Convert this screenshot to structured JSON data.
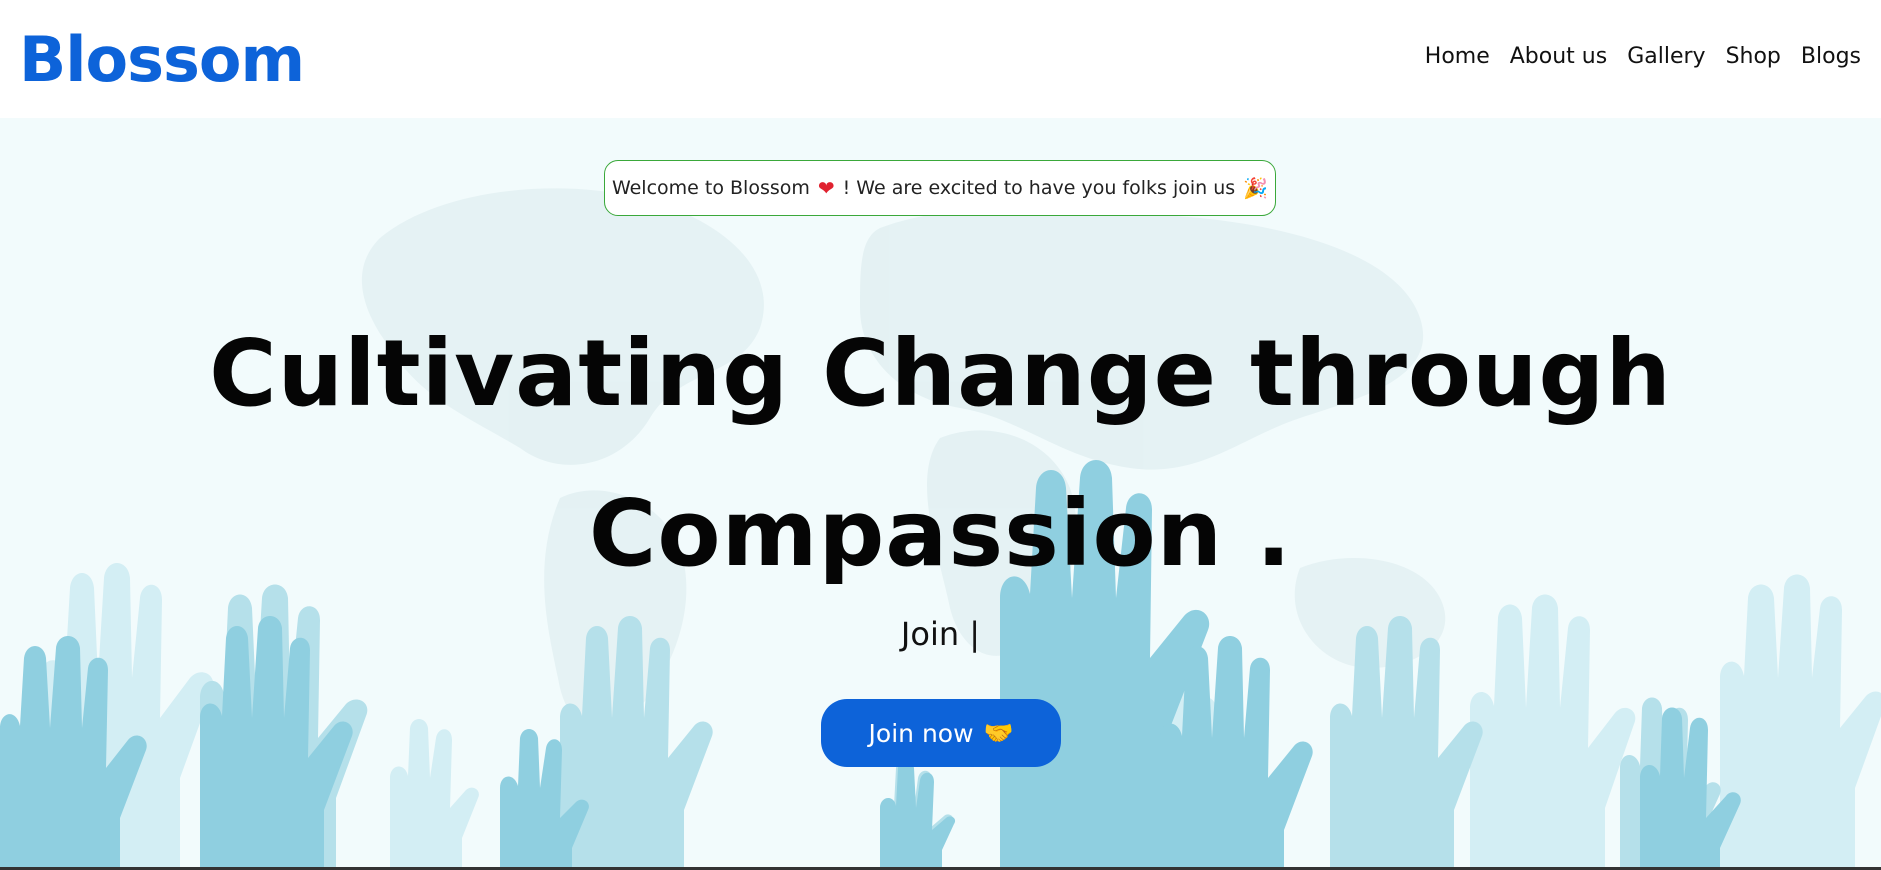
{
  "brand": {
    "name": "Blossom",
    "color": "#0d63d9"
  },
  "nav": {
    "items": [
      {
        "label": "Home"
      },
      {
        "label": "About us"
      },
      {
        "label": "Gallery"
      },
      {
        "label": "Shop"
      },
      {
        "label": "Blogs"
      }
    ]
  },
  "hero": {
    "welcome": {
      "text_before": "Welcome to Blossom",
      "heart_icon": "❤",
      "text_after": "! We are excited to have you folks join us",
      "party_icon": "🎉"
    },
    "headline_line1": "Cultivating Change through",
    "headline_line2": "Compassion .",
    "typewriter": "Join |",
    "button": {
      "label": "Join now",
      "icon": "handshake-icon",
      "glyph": "🤝"
    },
    "background_color": "#f2fbfc",
    "hands_colors": [
      "#8fcfe0",
      "#b5e0ea",
      "#d3eef4"
    ]
  }
}
